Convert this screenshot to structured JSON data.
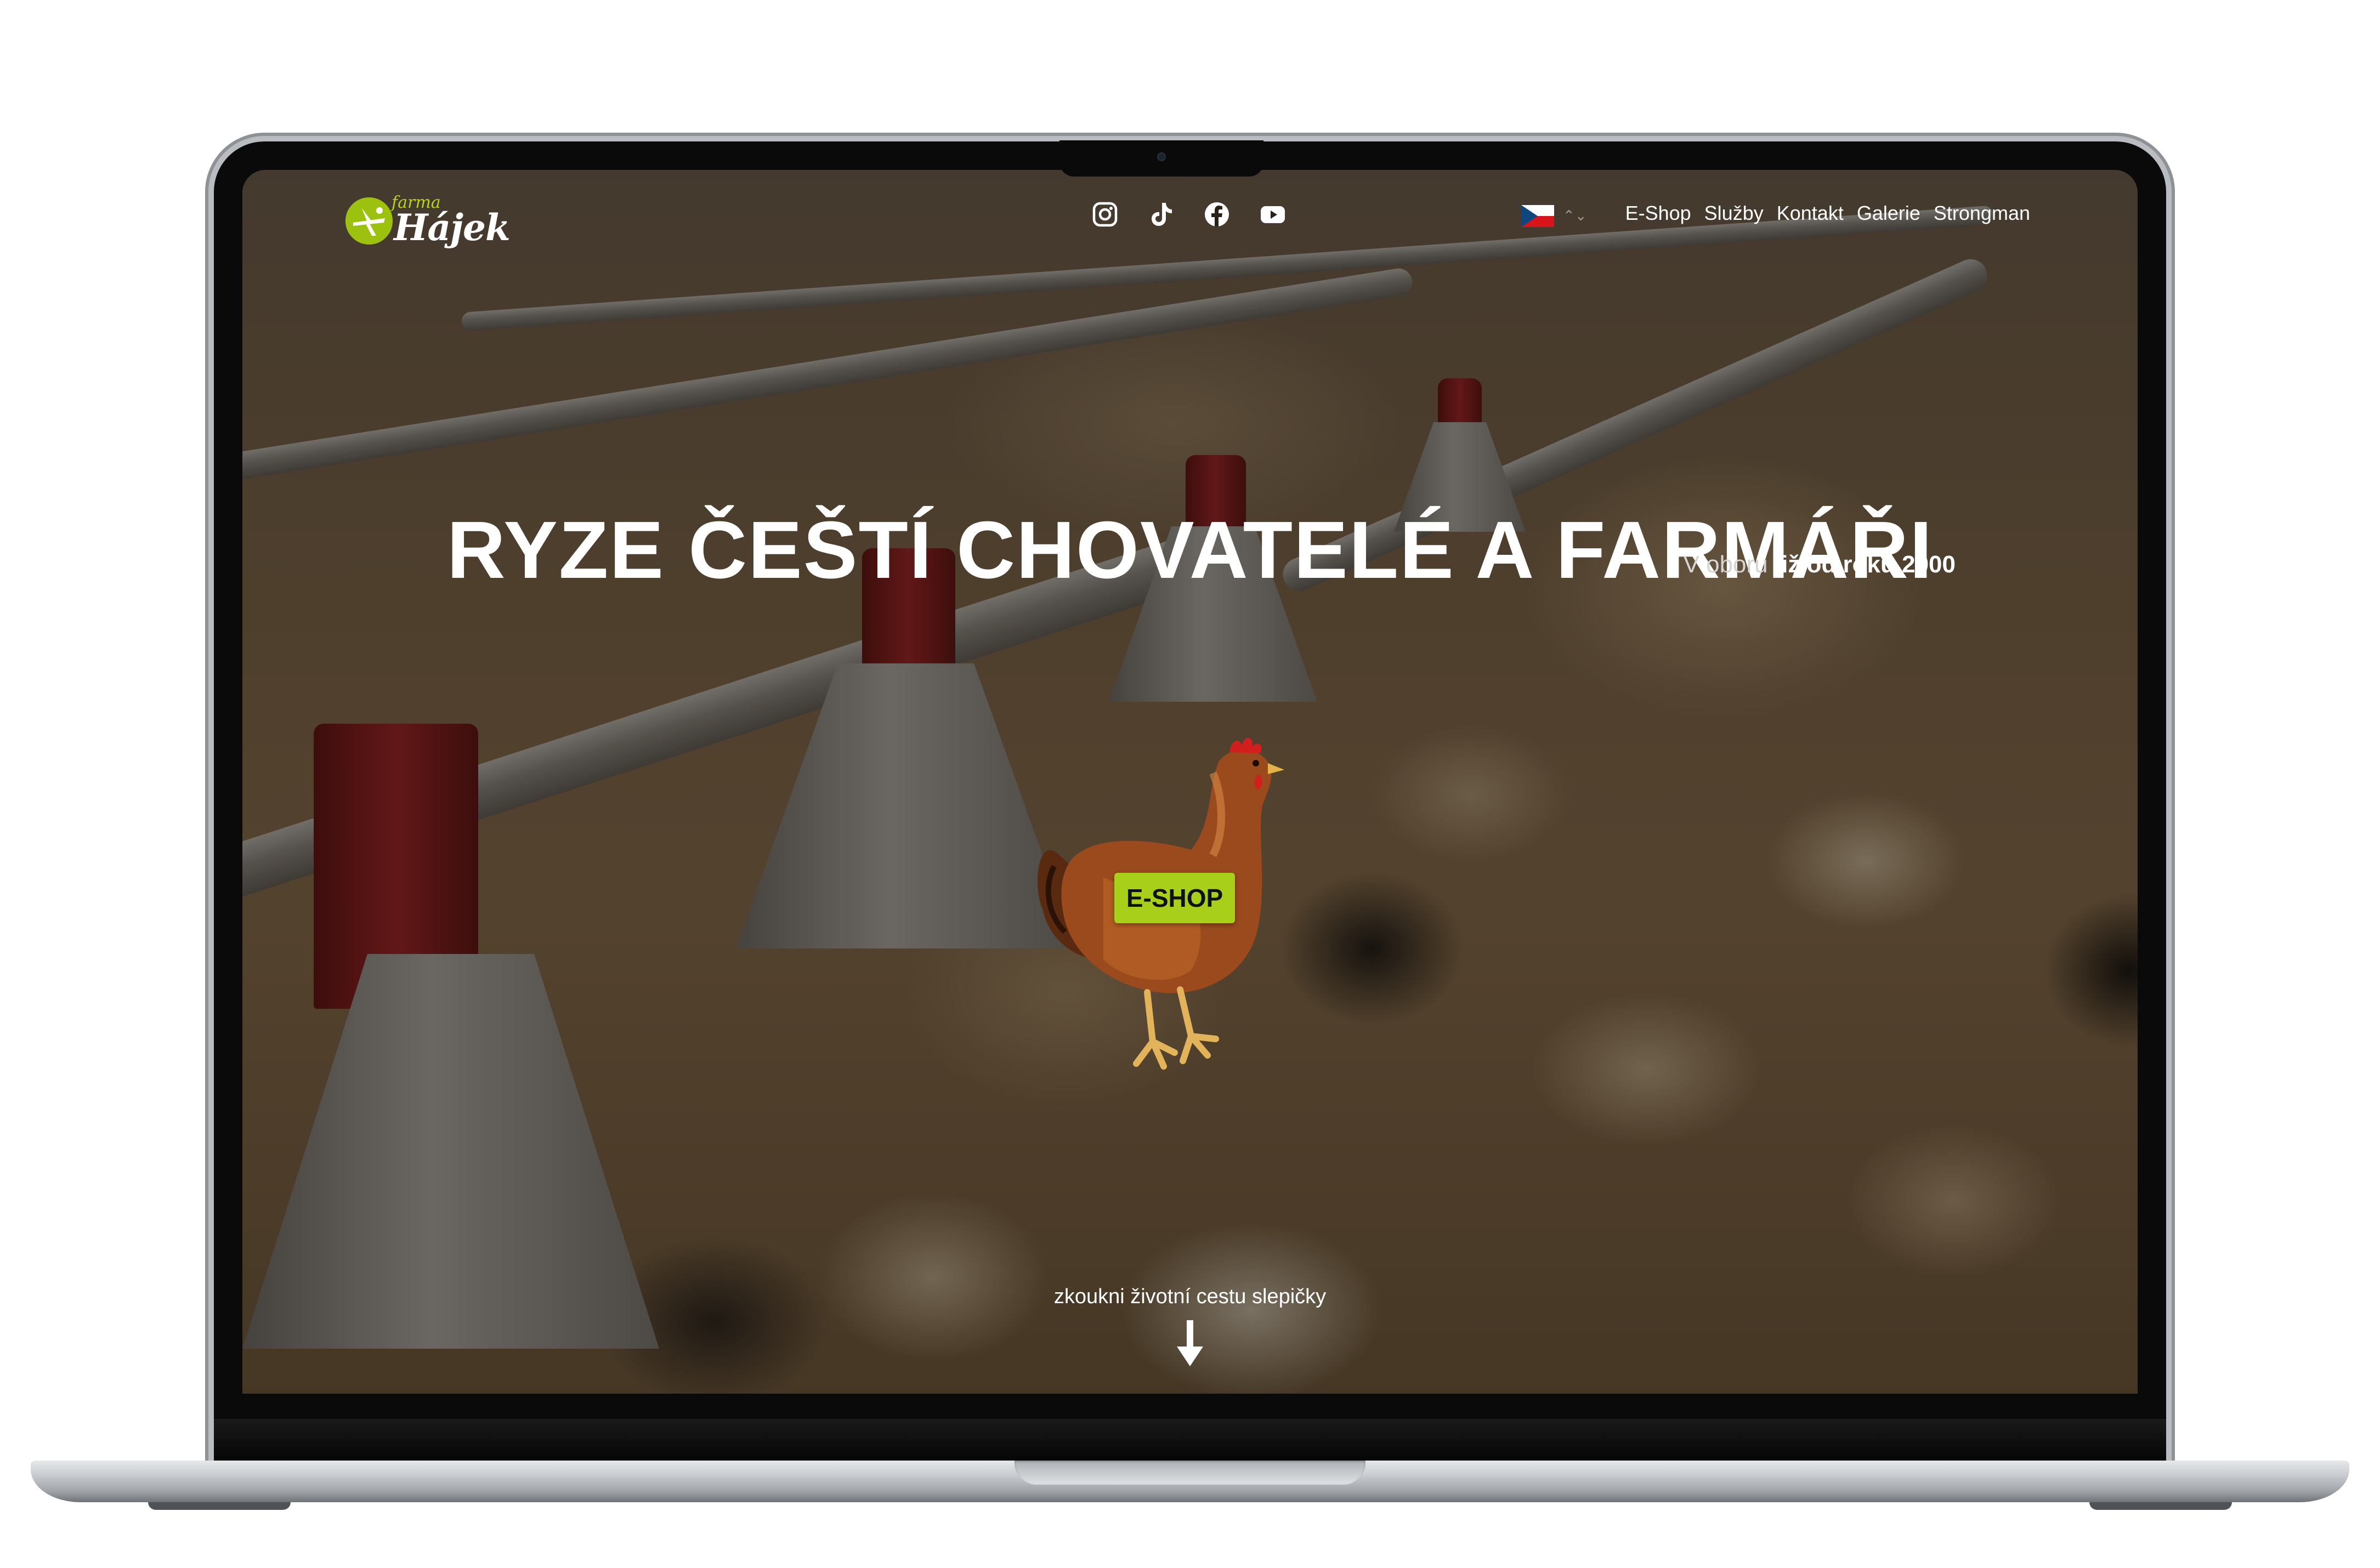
{
  "logo": {
    "top_text": "farma",
    "name": "Hájek"
  },
  "social": [
    "instagram-icon",
    "tiktok-icon",
    "facebook-icon",
    "youtube-icon"
  ],
  "language": {
    "flag": "czech-flag-icon",
    "caret": "⌃⌄"
  },
  "menu": [
    "E-Shop",
    "Služby",
    "Kontakt",
    "Galerie",
    "Strongman"
  ],
  "hero": {
    "title": "RYZE ČEŠTÍ CHOVATELÉ A FARMÁŘI",
    "subtitle_prefix": "V oboru ",
    "subtitle_bold": "již od roku 2000",
    "cta": "E-SHOP",
    "scroll_hint": "zkoukni životní cestu slepičky"
  },
  "colors": {
    "accent": "#a8cf1a",
    "logo_green": "#9cc10e"
  }
}
